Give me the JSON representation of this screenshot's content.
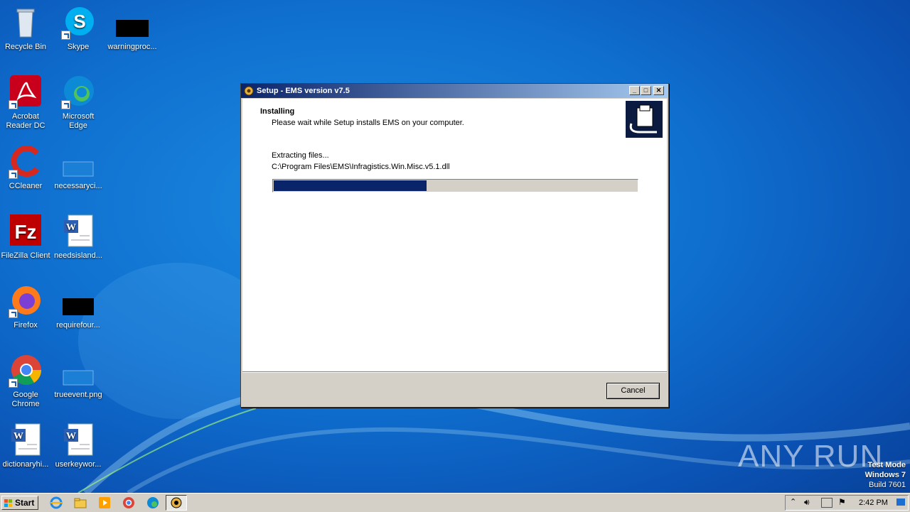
{
  "desktop": {
    "icons": [
      {
        "label": "Recycle Bin"
      },
      {
        "label": "Skype"
      },
      {
        "label": "warningproc..."
      },
      {
        "label": "Acrobat Reader DC"
      },
      {
        "label": "Microsoft Edge"
      },
      {
        "label": "CCleaner"
      },
      {
        "label": "necessaryci..."
      },
      {
        "label": "FileZilla Client"
      },
      {
        "label": "needsisland..."
      },
      {
        "label": "Firefox"
      },
      {
        "label": "requirefour..."
      },
      {
        "label": "Google Chrome"
      },
      {
        "label": "trueevent.png"
      },
      {
        "label": "dictionaryhi..."
      },
      {
        "label": "userkeywor..."
      }
    ]
  },
  "window": {
    "title": "Setup - EMS version v7.5",
    "heading": "Installing",
    "subheading": "Please wait while Setup installs EMS on your computer.",
    "status": "Extracting files...",
    "path": "C:\\Program Files\\EMS\\Infragistics.Win.Misc.v5.1.dll",
    "progress_fraction": 0.42,
    "cancel_label": "Cancel"
  },
  "watermark": {
    "brand": "ANY RUN",
    "line1": "Test Mode",
    "line2": "Windows 7",
    "line3": "Build 7601"
  },
  "taskbar": {
    "start_label": "Start",
    "clock": "2:42 PM"
  }
}
